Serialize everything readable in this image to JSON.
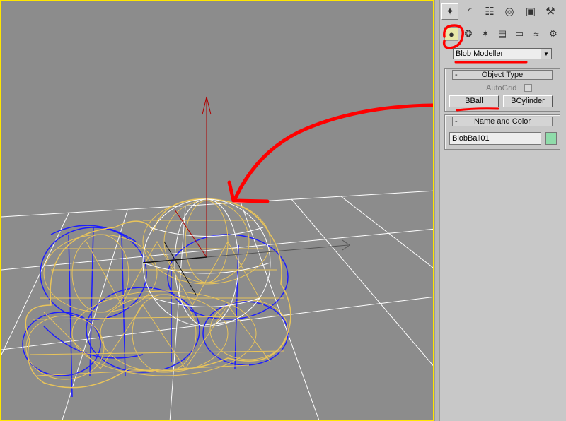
{
  "panel": {
    "tabs": [
      {
        "icon": "create-icon",
        "glyph": "✦",
        "active": true
      },
      {
        "icon": "modify-icon",
        "glyph": "◜",
        "active": false
      },
      {
        "icon": "hierarchy-icon",
        "glyph": "☷",
        "active": false
      },
      {
        "icon": "motion-icon",
        "glyph": "◎",
        "active": false
      },
      {
        "icon": "display-icon",
        "glyph": "▣",
        "active": false
      },
      {
        "icon": "utilities-icon",
        "glyph": "⚒",
        "active": false
      }
    ],
    "subtabs": [
      {
        "icon": "geometry-icon",
        "glyph": "●",
        "active": true
      },
      {
        "icon": "shapes-icon",
        "glyph": "❂",
        "active": false
      },
      {
        "icon": "lights-icon",
        "glyph": "✶",
        "active": false
      },
      {
        "icon": "cameras-icon",
        "glyph": "▤",
        "active": false
      },
      {
        "icon": "helpers-icon",
        "glyph": "▭",
        "active": false
      },
      {
        "icon": "spacewarps-icon",
        "glyph": "≈",
        "active": false
      },
      {
        "icon": "systems-icon",
        "glyph": "⚙",
        "active": false
      }
    ],
    "category_dropdown": {
      "value": "Blob Modeller"
    },
    "object_type": {
      "title": "Object Type",
      "toggle": "-",
      "autogrid_label": "AutoGrid",
      "buttons": [
        "BBall",
        "BCylinder"
      ]
    },
    "name_color": {
      "title": "Name and Color",
      "toggle": "-",
      "name_value": "BlobBall01",
      "color": "#8fdcaa"
    }
  },
  "colors": {
    "viewport_bg": "#8c8c8c",
    "viewport_border": "#ffe600",
    "grid": "#ffffff",
    "blob_wire": "#e9c45a",
    "sphere_wire": "#1c1cff",
    "annotation": "#ff0000",
    "gizmo_z": "#b00000"
  }
}
